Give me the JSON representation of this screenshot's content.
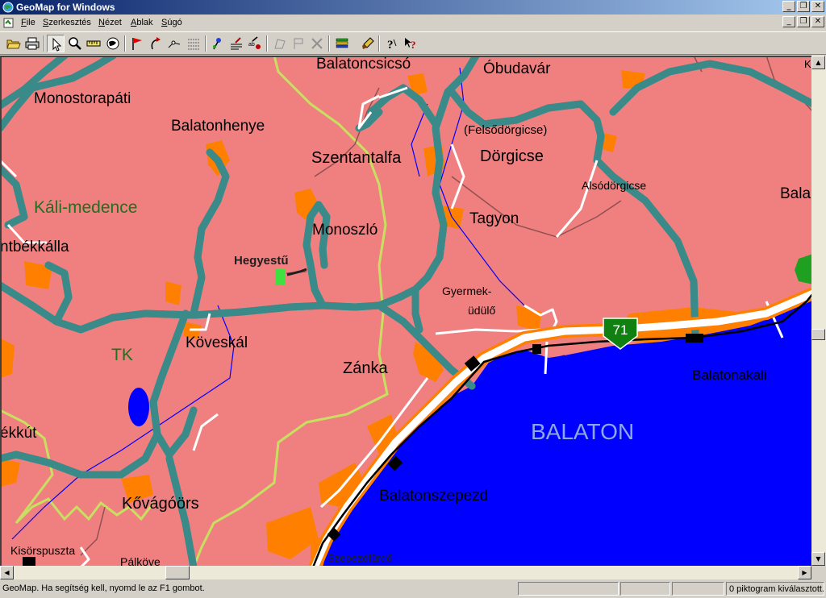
{
  "window": {
    "title": "GeoMap for Windows",
    "minimize": "_",
    "restore": "❐",
    "close": "✕"
  },
  "menu": [
    {
      "label": "File",
      "key": "F",
      "rest": "ile"
    },
    {
      "label": "Szerkesztés",
      "key": "S",
      "rest": "zerkesztés"
    },
    {
      "label": "Nézet",
      "key": "N",
      "rest": "ézet"
    },
    {
      "label": "Ablak",
      "key": "A",
      "rest": "blak"
    },
    {
      "label": "Súgó",
      "key": "S",
      "rest": "úgó"
    }
  ],
  "toolbar": {
    "tools": [
      "open-icon",
      "print-icon",
      "select-arrow-icon",
      "zoom-icon",
      "measure-ruler-icon",
      "globe-icon",
      "flag-icon",
      "undo-curve-icon",
      "point-edit-icon",
      "grid-icon",
      "pin-icon",
      "list-edit-icon",
      "label-edit-icon",
      "polygon-disabled-icon",
      "flag-disabled-icon",
      "delete-disabled-icon",
      "layers-icon",
      "brush-icon",
      "help-icon",
      "context-help-icon"
    ]
  },
  "map": {
    "colors": {
      "land": "#f08080",
      "water": "#0000ff",
      "urban": "#ff8000",
      "road": "#e0ecec",
      "road_outline": "#3a8a8a",
      "main_road": "#ffffff",
      "boundary": "#c8e060",
      "railway": "#000000",
      "label_green": "#207020",
      "lake_label": "#8ca8e0"
    },
    "labels": {
      "balatoncsicso": "Balatoncsicsó",
      "obudavar": "Óbudavár",
      "monostorapati": "Monostorapáti",
      "balatonhenye": "Balatonhenye",
      "felsodorgicse": "(Felsődörgicse)",
      "dorgicse": "Dörgicse",
      "szentantalfa": "Szentantalfa",
      "also_dorgicse": "Alsódörgicse",
      "bala": "Bala",
      "kali_medence": "Káli-medence",
      "tagyon": "Tagyon",
      "monoszlo": "Monoszló",
      "ntbekkalla": "ntbékkálla",
      "hegyestu": "Hegyestű",
      "gyermek": "Gyermek-",
      "udulo": "üdülő",
      "tk": "TK",
      "koveskal": "Köveskál",
      "zanka": "Zánka",
      "balatonakali": "Balatonakali",
      "balaton": "BALATON",
      "ekkut": "ékkút",
      "balatonszepezd": "Balatonszepezd",
      "kovagoors": "Kővágóörs",
      "kisorspuszta": "Kisörspuszta",
      "palkove": "Pálköve",
      "szepezdfurdo": "Szepezdfürdő",
      "k": "K",
      "route_71": "71"
    }
  },
  "scrollbars": {
    "vertical": {
      "position": 0.55
    },
    "horizontal": {
      "position": 0.2
    }
  },
  "status": {
    "message": "GeoMap. Ha segítség kell, nyomd le az F1 gombot.",
    "selection": "0 piktogram kiválasztott."
  }
}
